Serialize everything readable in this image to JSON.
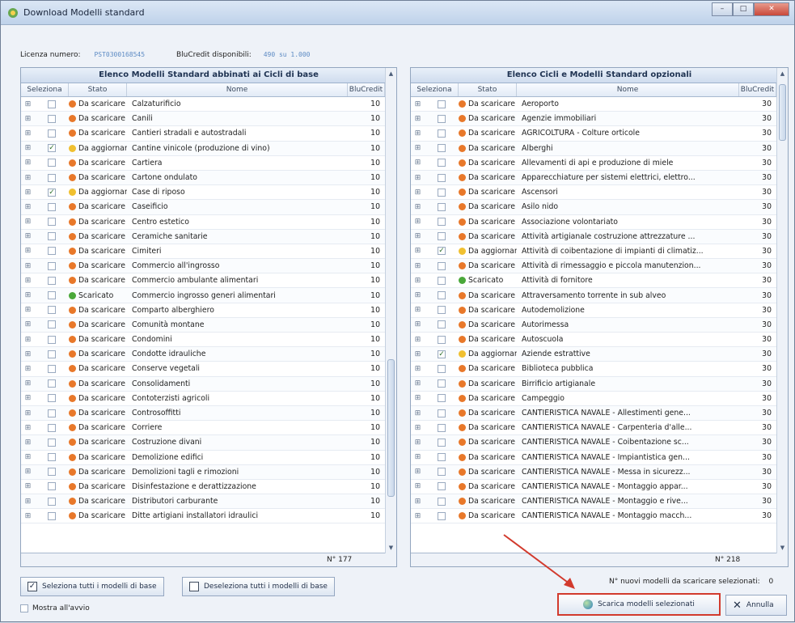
{
  "window": {
    "title": "Download Modelli standard"
  },
  "licence": {
    "label": "Licenza numero:",
    "value": "PST0300168545",
    "credit_label": "BluCredit disponibili:",
    "credit_value": "490 su 1.000"
  },
  "columns": {
    "seleziona": "Seleziona",
    "stato": "Stato",
    "nome": "Nome",
    "blucredit": "BluCredit"
  },
  "left": {
    "title": "Elenco Modelli Standard abbinati ai Cicli di base",
    "count": "N° 177",
    "rows": [
      {
        "stato": "Da scaricare",
        "nome": "Calzaturificio",
        "credit": "10",
        "checked": false,
        "status": "scaricare"
      },
      {
        "stato": "Da scaricare",
        "nome": "Canili",
        "credit": "10",
        "checked": false,
        "status": "scaricare"
      },
      {
        "stato": "Da scaricare",
        "nome": "Cantieri stradali e autostradali",
        "credit": "10",
        "checked": false,
        "status": "scaricare"
      },
      {
        "stato": "Da aggiornare",
        "nome": "Cantine vinicole (produzione di vino)",
        "credit": "10",
        "checked": true,
        "status": "aggiornare"
      },
      {
        "stato": "Da scaricare",
        "nome": "Cartiera",
        "credit": "10",
        "checked": false,
        "status": "scaricare"
      },
      {
        "stato": "Da scaricare",
        "nome": "Cartone ondulato",
        "credit": "10",
        "checked": false,
        "status": "scaricare"
      },
      {
        "stato": "Da aggiornare",
        "nome": "Case di riposo",
        "credit": "10",
        "checked": true,
        "status": "aggiornare"
      },
      {
        "stato": "Da scaricare",
        "nome": "Caseificio",
        "credit": "10",
        "checked": false,
        "status": "scaricare"
      },
      {
        "stato": "Da scaricare",
        "nome": "Centro estetico",
        "credit": "10",
        "checked": false,
        "status": "scaricare"
      },
      {
        "stato": "Da scaricare",
        "nome": "Ceramiche sanitarie",
        "credit": "10",
        "checked": false,
        "status": "scaricare"
      },
      {
        "stato": "Da scaricare",
        "nome": "Cimiteri",
        "credit": "10",
        "checked": false,
        "status": "scaricare"
      },
      {
        "stato": "Da scaricare",
        "nome": "Commercio all'ingrosso",
        "credit": "10",
        "checked": false,
        "status": "scaricare"
      },
      {
        "stato": "Da scaricare",
        "nome": "Commercio ambulante alimentari",
        "credit": "10",
        "checked": false,
        "status": "scaricare"
      },
      {
        "stato": "Scaricato",
        "nome": "Commercio ingrosso generi alimentari",
        "credit": "10",
        "checked": false,
        "status": "scaricato"
      },
      {
        "stato": "Da scaricare",
        "nome": "Comparto alberghiero",
        "credit": "10",
        "checked": false,
        "status": "scaricare"
      },
      {
        "stato": "Da scaricare",
        "nome": "Comunità montane",
        "credit": "10",
        "checked": false,
        "status": "scaricare"
      },
      {
        "stato": "Da scaricare",
        "nome": "Condomini",
        "credit": "10",
        "checked": false,
        "status": "scaricare"
      },
      {
        "stato": "Da scaricare",
        "nome": "Condotte idrauliche",
        "credit": "10",
        "checked": false,
        "status": "scaricare"
      },
      {
        "stato": "Da scaricare",
        "nome": "Conserve vegetali",
        "credit": "10",
        "checked": false,
        "status": "scaricare"
      },
      {
        "stato": "Da scaricare",
        "nome": "Consolidamenti",
        "credit": "10",
        "checked": false,
        "status": "scaricare"
      },
      {
        "stato": "Da scaricare",
        "nome": "Contoterzisti agricoli",
        "credit": "10",
        "checked": false,
        "status": "scaricare"
      },
      {
        "stato": "Da scaricare",
        "nome": "Controsoffitti",
        "credit": "10",
        "checked": false,
        "status": "scaricare"
      },
      {
        "stato": "Da scaricare",
        "nome": "Corriere",
        "credit": "10",
        "checked": false,
        "status": "scaricare"
      },
      {
        "stato": "Da scaricare",
        "nome": "Costruzione divani",
        "credit": "10",
        "checked": false,
        "status": "scaricare"
      },
      {
        "stato": "Da scaricare",
        "nome": "Demolizione edifici",
        "credit": "10",
        "checked": false,
        "status": "scaricare"
      },
      {
        "stato": "Da scaricare",
        "nome": "Demolizioni tagli e rimozioni",
        "credit": "10",
        "checked": false,
        "status": "scaricare"
      },
      {
        "stato": "Da scaricare",
        "nome": "Disinfestazione e derattizzazione",
        "credit": "10",
        "checked": false,
        "status": "scaricare"
      },
      {
        "stato": "Da scaricare",
        "nome": "Distributori carburante",
        "credit": "10",
        "checked": false,
        "status": "scaricare"
      },
      {
        "stato": "Da scaricare",
        "nome": "Ditte artigiani installatori idraulici",
        "credit": "10",
        "checked": false,
        "status": "scaricare"
      }
    ]
  },
  "right": {
    "title": "Elenco Cicli e Modelli Standard opzionali",
    "count": "N° 218",
    "rows": [
      {
        "stato": "Da scaricare",
        "nome": "Aeroporto",
        "credit": "30",
        "checked": false,
        "status": "scaricare"
      },
      {
        "stato": "Da scaricare",
        "nome": "Agenzie immobiliari",
        "credit": "30",
        "checked": false,
        "status": "scaricare"
      },
      {
        "stato": "Da scaricare",
        "nome": "AGRICOLTURA - Colture orticole",
        "credit": "30",
        "checked": false,
        "status": "scaricare"
      },
      {
        "stato": "Da scaricare",
        "nome": "Alberghi",
        "credit": "30",
        "checked": false,
        "status": "scaricare"
      },
      {
        "stato": "Da scaricare",
        "nome": "Allevamenti di api e produzione di miele",
        "credit": "30",
        "checked": false,
        "status": "scaricare"
      },
      {
        "stato": "Da scaricare",
        "nome": "Apparecchiature per sistemi elettrici, elettro...",
        "credit": "30",
        "checked": false,
        "status": "scaricare"
      },
      {
        "stato": "Da scaricare",
        "nome": "Ascensori",
        "credit": "30",
        "checked": false,
        "status": "scaricare"
      },
      {
        "stato": "Da scaricare",
        "nome": "Asilo nido",
        "credit": "30",
        "checked": false,
        "status": "scaricare"
      },
      {
        "stato": "Da scaricare",
        "nome": "Associazione volontariato",
        "credit": "30",
        "checked": false,
        "status": "scaricare"
      },
      {
        "stato": "Da scaricare",
        "nome": "Attività artigianale costruzione attrezzature ...",
        "credit": "30",
        "checked": false,
        "status": "scaricare"
      },
      {
        "stato": "Da aggiornare",
        "nome": "Attività di coibentazione di impianti di climatiz...",
        "credit": "30",
        "checked": true,
        "status": "aggiornare"
      },
      {
        "stato": "Da scaricare",
        "nome": "Attività di rimessaggio e piccola manutenzion...",
        "credit": "30",
        "checked": false,
        "status": "scaricare"
      },
      {
        "stato": "Scaricato",
        "nome": "Attività di fornitore",
        "credit": "30",
        "checked": false,
        "status": "scaricato"
      },
      {
        "stato": "Da scaricare",
        "nome": "Attraversamento torrente in sub alveo",
        "credit": "30",
        "checked": false,
        "status": "scaricare"
      },
      {
        "stato": "Da scaricare",
        "nome": "Autodemolizione",
        "credit": "30",
        "checked": false,
        "status": "scaricare"
      },
      {
        "stato": "Da scaricare",
        "nome": "Autorimessa",
        "credit": "30",
        "checked": false,
        "status": "scaricare"
      },
      {
        "stato": "Da scaricare",
        "nome": "Autoscuola",
        "credit": "30",
        "checked": false,
        "status": "scaricare"
      },
      {
        "stato": "Da aggiornare",
        "nome": "Aziende estrattive",
        "credit": "30",
        "checked": true,
        "status": "aggiornare"
      },
      {
        "stato": "Da scaricare",
        "nome": "Biblioteca pubblica",
        "credit": "30",
        "checked": false,
        "status": "scaricare"
      },
      {
        "stato": "Da scaricare",
        "nome": "Birrificio artigianale",
        "credit": "30",
        "checked": false,
        "status": "scaricare"
      },
      {
        "stato": "Da scaricare",
        "nome": "Campeggio",
        "credit": "30",
        "checked": false,
        "status": "scaricare"
      },
      {
        "stato": "Da scaricare",
        "nome": "CANTIERISTICA NAVALE - Allestimenti gene...",
        "credit": "30",
        "checked": false,
        "status": "scaricare"
      },
      {
        "stato": "Da scaricare",
        "nome": "CANTIERISTICA NAVALE - Carpenteria d'alle...",
        "credit": "30",
        "checked": false,
        "status": "scaricare"
      },
      {
        "stato": "Da scaricare",
        "nome": "CANTIERISTICA NAVALE - Coibentazione sc...",
        "credit": "30",
        "checked": false,
        "status": "scaricare"
      },
      {
        "stato": "Da scaricare",
        "nome": "CANTIERISTICA NAVALE - Impiantistica gen...",
        "credit": "30",
        "checked": false,
        "status": "scaricare"
      },
      {
        "stato": "Da scaricare",
        "nome": "CANTIERISTICA NAVALE - Messa in sicurezz...",
        "credit": "30",
        "checked": false,
        "status": "scaricare"
      },
      {
        "stato": "Da scaricare",
        "nome": "CANTIERISTICA NAVALE - Montaggio appar...",
        "credit": "30",
        "checked": false,
        "status": "scaricare"
      },
      {
        "stato": "Da scaricare",
        "nome": "CANTIERISTICA NAVALE - Montaggio e rive...",
        "credit": "30",
        "checked": false,
        "status": "scaricare"
      },
      {
        "stato": "Da scaricare",
        "nome": "CANTIERISTICA NAVALE - Montaggio macch...",
        "credit": "30",
        "checked": false,
        "status": "scaricare"
      }
    ]
  },
  "footer": {
    "select_all": "Seleziona tutti i modelli di base",
    "deselect_all": "Deseleziona tutti i modelli di base",
    "show_at_start": "Mostra all'avvio",
    "nuovi_label": "N° nuovi modelli da scaricare selezionati:",
    "nuovi_value": "0",
    "download": "Scarica modelli selezionati",
    "cancel": "Annulla"
  },
  "colors": {
    "scaricare": "#e8782a",
    "aggiornare": "#f0c030",
    "scaricato": "#4aa83a",
    "highlight": "#d23a2d"
  }
}
